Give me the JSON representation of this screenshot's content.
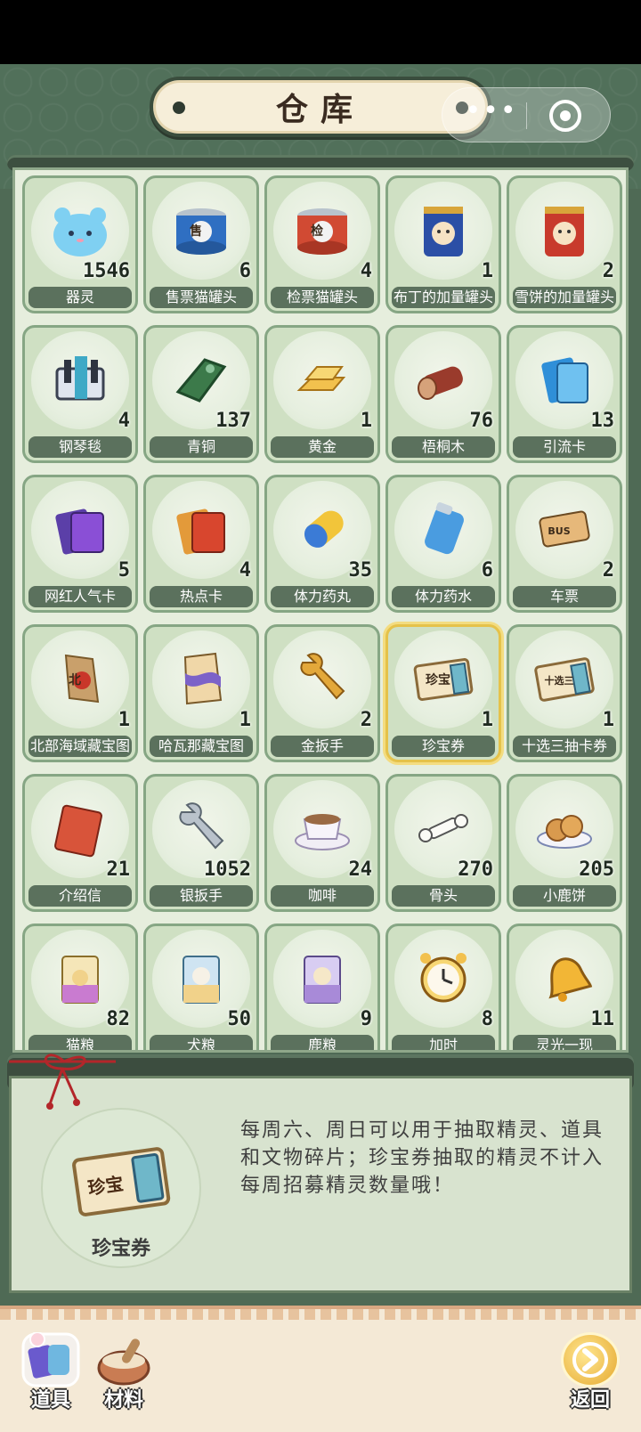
{
  "title": "仓库",
  "capsule": {
    "more": "•••"
  },
  "items": [
    {
      "name": "器灵",
      "count": "1546",
      "icon": "spirit-icon"
    },
    {
      "name": "售票猫罐头",
      "count": "6",
      "icon": "can-blue-icon",
      "mark": "售"
    },
    {
      "name": "检票猫罐头",
      "count": "4",
      "icon": "can-red-icon",
      "mark": "检"
    },
    {
      "name": "布丁的加量罐头",
      "count": "1",
      "icon": "can-pudding-icon"
    },
    {
      "name": "雪饼的加量罐头",
      "count": "2",
      "icon": "can-xuebing-icon"
    },
    {
      "name": "钢琴毯",
      "count": "4",
      "icon": "piano-blanket-icon"
    },
    {
      "name": "青铜",
      "count": "137",
      "icon": "bronze-icon"
    },
    {
      "name": "黄金",
      "count": "1",
      "icon": "gold-bar-icon"
    },
    {
      "name": "梧桐木",
      "count": "76",
      "icon": "wood-log-icon"
    },
    {
      "name": "引流卡",
      "count": "13",
      "icon": "blue-card-icon"
    },
    {
      "name": "网红人气卡",
      "count": "5",
      "icon": "purple-card-icon"
    },
    {
      "name": "热点卡",
      "count": "4",
      "icon": "red-card-icon"
    },
    {
      "name": "体力药丸",
      "count": "35",
      "icon": "pill-icon"
    },
    {
      "name": "体力药水",
      "count": "6",
      "icon": "potion-can-icon"
    },
    {
      "name": "车票",
      "count": "2",
      "icon": "bus-ticket-icon",
      "mark": "BUS"
    },
    {
      "name": "北部海域藏宝图",
      "count": "1",
      "icon": "treasure-map-north-icon",
      "mark": "北"
    },
    {
      "name": "哈瓦那藏宝图",
      "count": "1",
      "icon": "treasure-map-havana-icon"
    },
    {
      "name": "金扳手",
      "count": "2",
      "icon": "gold-wrench-icon"
    },
    {
      "name": "珍宝券",
      "count": "1",
      "icon": "treasure-ticket-icon",
      "mark": "珍宝",
      "selected": true
    },
    {
      "name": "十选三抽卡券",
      "count": "1",
      "icon": "draw-ticket-icon",
      "mark": "十选三"
    },
    {
      "name": "介绍信",
      "count": "21",
      "icon": "letter-icon"
    },
    {
      "name": "银扳手",
      "count": "1052",
      "icon": "silver-wrench-icon"
    },
    {
      "name": "咖啡",
      "count": "24",
      "icon": "coffee-icon"
    },
    {
      "name": "骨头",
      "count": "270",
      "icon": "bone-icon"
    },
    {
      "name": "小鹿饼",
      "count": "205",
      "icon": "cookie-icon"
    },
    {
      "name": "猫粮",
      "count": "82",
      "icon": "cat-food-icon"
    },
    {
      "name": "犬粮",
      "count": "50",
      "icon": "dog-food-icon"
    },
    {
      "name": "鹿粮",
      "count": "9",
      "icon": "deer-food-icon"
    },
    {
      "name": "加时",
      "count": "8",
      "icon": "alarm-clock-icon"
    },
    {
      "name": "灵光一现",
      "count": "11",
      "icon": "bell-icon"
    }
  ],
  "detail": {
    "name": "珍宝券",
    "icon": "treasure-ticket-icon",
    "mark": "珍宝",
    "description": "每周六、周日可以用于抽取精灵、道具和文物碎片；珍宝券抽取的精灵不计入每周招募精灵数量哦！"
  },
  "bottom": {
    "tab_items": "道具",
    "tab_materials": "材料",
    "back": "返回"
  },
  "colors": {
    "frame": "#4f6a55",
    "cell_bg": "#cfe0c3",
    "label_bg": "#5b715d",
    "selected_border": "#e5c24a"
  }
}
